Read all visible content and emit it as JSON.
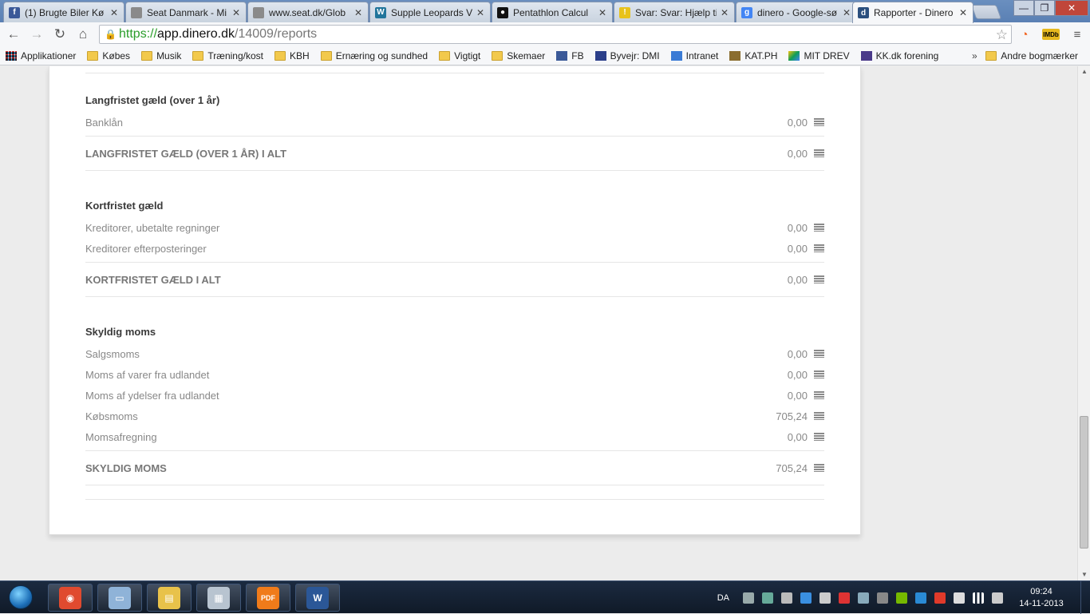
{
  "browser": {
    "tabs": [
      {
        "title": "(1) Brugte Biler Kø",
        "icon": "facebook-icon",
        "color": "#3b5998",
        "glyph": "f"
      },
      {
        "title": "Seat Danmark - Mi",
        "icon": "page-icon",
        "color": "#8a8a8a",
        "glyph": ""
      },
      {
        "title": "www.seat.dk/Glob",
        "icon": "page-icon",
        "color": "#8a8a8a",
        "glyph": ""
      },
      {
        "title": "Supple Leopards V",
        "icon": "wordpress-icon",
        "color": "#21759b",
        "glyph": "W"
      },
      {
        "title": "Pentathlon Calcul",
        "icon": "kettlebell-icon",
        "color": "#111111",
        "glyph": "●"
      },
      {
        "title": "Svar: Svar: Hjælp ti",
        "icon": "lightbulb-icon",
        "color": "#e8c21a",
        "glyph": "!"
      },
      {
        "title": "dinero - Google-sø",
        "icon": "google-icon",
        "color": "#4285f4",
        "glyph": "g"
      },
      {
        "title": "Rapporter - Dinero",
        "icon": "dinero-icon",
        "color": "#2b4f7e",
        "glyph": "d"
      }
    ],
    "active_tab": 7,
    "url": {
      "scheme": "https://",
      "host": "app.dinero.dk",
      "path": "/14009/reports"
    },
    "bookmarks": [
      {
        "label": "Applikationer",
        "icon": "apps-icon"
      },
      {
        "label": "Købes",
        "icon": "folder-icon"
      },
      {
        "label": "Musik",
        "icon": "folder-icon"
      },
      {
        "label": "Træning/kost",
        "icon": "folder-icon"
      },
      {
        "label": "KBH",
        "icon": "folder-icon"
      },
      {
        "label": "Ernæring og sundhed",
        "icon": "folder-icon"
      },
      {
        "label": "Vigtigt",
        "icon": "folder-icon"
      },
      {
        "label": "Skemaer",
        "icon": "folder-icon"
      },
      {
        "label": "FB",
        "icon": "facebook-icon"
      },
      {
        "label": "Byvejr: DMI",
        "icon": "crown-icon"
      },
      {
        "label": "Intranet",
        "icon": "arrow-icon"
      },
      {
        "label": "KAT.PH",
        "icon": "shield-icon"
      },
      {
        "label": "MIT DREV",
        "icon": "drive-icon"
      },
      {
        "label": "KK.dk forening",
        "icon": "emblem-icon"
      }
    ],
    "bookmarks_more": "»",
    "other_bookmarks": "Andre bogmærker"
  },
  "report": {
    "sections": [
      {
        "title": "Langfristet gæld (over 1 år)",
        "rows": [
          {
            "label": "Banklån",
            "amount": "0,00"
          }
        ],
        "total": {
          "label": "LANGFRISTET GÆLD (OVER 1 ÅR) I ALT",
          "amount": "0,00"
        }
      },
      {
        "title": "Kortfristet gæld",
        "rows": [
          {
            "label": "Kreditorer, ubetalte regninger",
            "amount": "0,00"
          },
          {
            "label": "Kreditorer efterposteringer",
            "amount": "0,00"
          }
        ],
        "total": {
          "label": "KORTFRISTET GÆLD I ALT",
          "amount": "0,00"
        }
      },
      {
        "title": "Skyldig moms",
        "rows": [
          {
            "label": "Salgsmoms",
            "amount": "0,00"
          },
          {
            "label": "Moms af varer fra udlandet",
            "amount": "0,00"
          },
          {
            "label": "Moms af ydelser fra udlandet",
            "amount": "0,00"
          },
          {
            "label": "Købsmoms",
            "amount": "705,24"
          },
          {
            "label": "Momsafregning",
            "amount": "0,00"
          }
        ],
        "total": {
          "label": "SKYLDIG MOMS",
          "amount": "705,24"
        }
      }
    ]
  },
  "taskbar": {
    "apps": [
      {
        "name": "chrome-icon",
        "color": "#e04a2f",
        "glyph": "◉"
      },
      {
        "name": "explorer-window-icon",
        "color": "#8fb3d8",
        "glyph": "▭"
      },
      {
        "name": "folder-icon",
        "color": "#e8c24a",
        "glyph": "▤"
      },
      {
        "name": "calculator-icon",
        "color": "#b8c4d0",
        "glyph": "▦"
      },
      {
        "name": "pdf-icon",
        "color": "#f07b1a",
        "glyph": "PDF"
      },
      {
        "name": "word-icon",
        "color": "#2b5797",
        "glyph": "W"
      }
    ],
    "language": "DA",
    "time": "09:24",
    "date": "14-11-2013"
  }
}
